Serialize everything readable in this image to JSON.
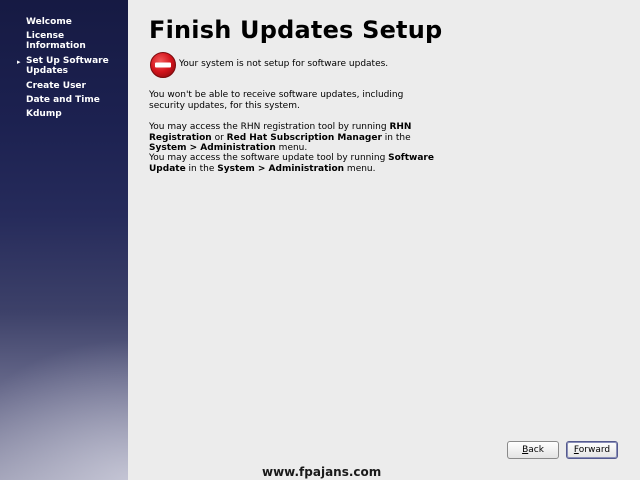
{
  "sidebar": {
    "items": [
      {
        "label": "Welcome",
        "active": false
      },
      {
        "label": "License\nInformation",
        "active": false
      },
      {
        "label": "Set Up Software\nUpdates",
        "active": true
      },
      {
        "label": "Create User",
        "active": false
      },
      {
        "label": "Date and Time",
        "active": false
      },
      {
        "label": "Kdump",
        "active": false
      }
    ],
    "active_marker": "▸"
  },
  "main": {
    "title": "Finish Updates Setup",
    "warning_icon": "stop-icon",
    "warning_text": "Your system is not setup for software updates.",
    "para1": "You won't be able to receive software updates, including security updates, for this system.",
    "para2": {
      "t1": "You may access the RHN registration tool by running ",
      "b1": "RHN Registration",
      "t2": " or ",
      "b2": "Red Hat Subscription Manager",
      "t3": " in the ",
      "b3": "System > Administration",
      "t4": " menu."
    },
    "para3": {
      "t1": "You may access the software update tool by running ",
      "b1": "Software Update",
      "t2": " in the ",
      "b2": "System > Administration",
      "t3": " menu."
    }
  },
  "buttons": {
    "back_mnemonic": "B",
    "back_rest": "ack",
    "forward_mnemonic": "F",
    "forward_rest": "orward"
  },
  "watermark": "www.fpajans.com",
  "colors": {
    "sidebar_top": "#161a43",
    "stop_red": "#d4141c"
  }
}
